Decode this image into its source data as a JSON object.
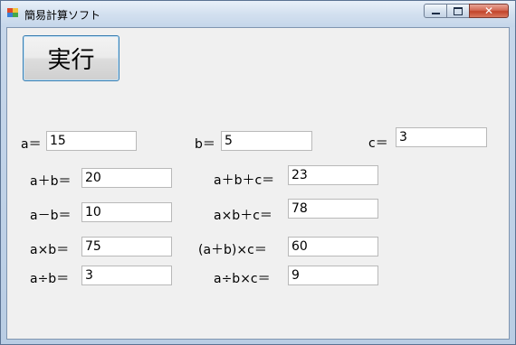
{
  "window": {
    "title": "簡易計算ソフト",
    "min_glyph": "▭",
    "max_glyph": "▫",
    "close_glyph": "✕"
  },
  "run_button": {
    "label": "実行"
  },
  "inputs": {
    "a": {
      "label": "a＝",
      "value": "15"
    },
    "b": {
      "label": "b＝",
      "value": "5"
    },
    "c": {
      "label": "c＝",
      "value": "3"
    }
  },
  "results": {
    "a_plus_b": {
      "label": "a＋b＝",
      "value": "20"
    },
    "a_minus_b": {
      "label": "a－b＝",
      "value": "10"
    },
    "a_times_b": {
      "label": "a×b＝",
      "value": "75"
    },
    "a_div_b": {
      "label": "a÷b＝",
      "value": "3"
    },
    "a_plus_b_plus_c": {
      "label": "a＋b＋c＝",
      "value": "23"
    },
    "a_times_b_plus_c": {
      "label": "a×b＋c＝",
      "value": "78"
    },
    "paren_a_plus_b_times_c": {
      "label": "(a＋b)×c＝",
      "value": "60"
    },
    "a_div_b_times_c": {
      "label": "a÷b×c＝",
      "value": "9"
    }
  },
  "icons": {
    "app": "app-icon",
    "minimize": "minimize-icon",
    "maximize": "maximize-icon",
    "close": "close-icon"
  }
}
